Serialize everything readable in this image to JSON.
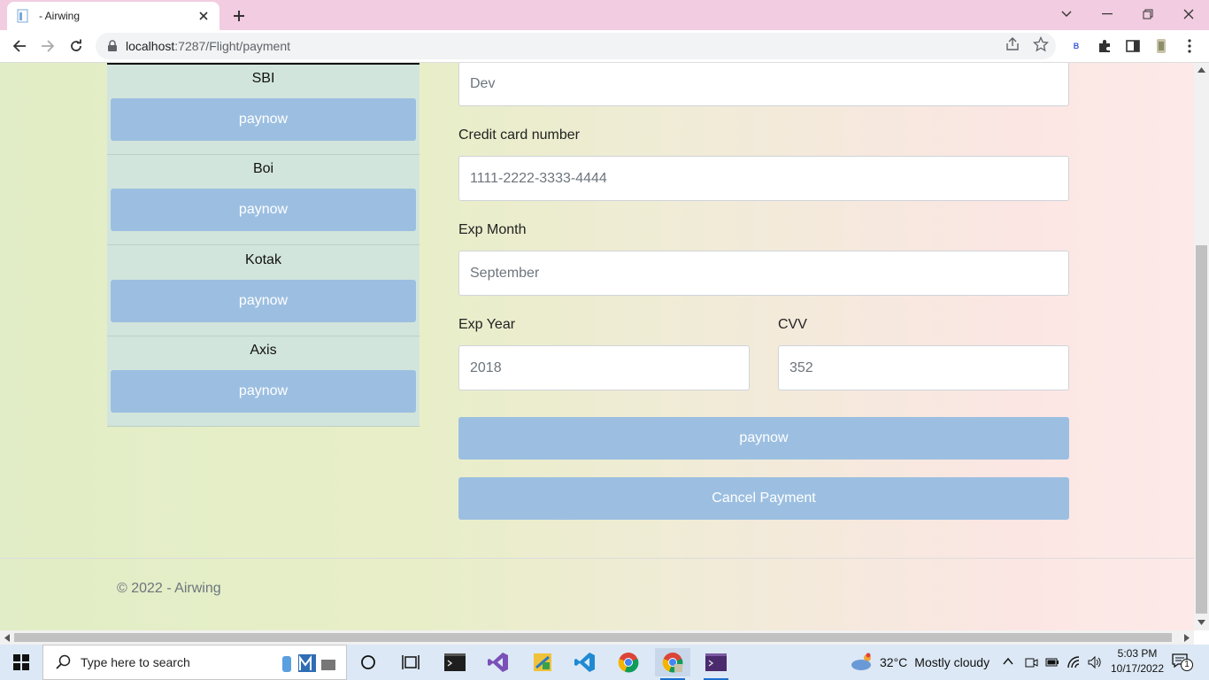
{
  "browser": {
    "tab_title": "- Airwing",
    "url_host": "localhost",
    "url_rest": ":7287/Flight/payment",
    "profile_letter": "B"
  },
  "banks": [
    {
      "name": "SBI",
      "button": "paynow"
    },
    {
      "name": "Boi",
      "button": "paynow"
    },
    {
      "name": "Kotak",
      "button": "paynow"
    },
    {
      "name": "Axis",
      "button": "paynow"
    }
  ],
  "form": {
    "name_value": "Dev",
    "card_label": "Credit card number",
    "card_value": "1111-2222-3333-4444",
    "month_label": "Exp Month",
    "month_value": "September",
    "year_label": "Exp Year",
    "year_value": "2018",
    "cvv_label": "CVV",
    "cvv_value": "352",
    "pay_button": "paynow",
    "cancel_button": "Cancel Payment"
  },
  "footer": {
    "text": "© 2022 - Airwing"
  },
  "taskbar": {
    "search_placeholder": "Type here to search",
    "weather_temp": "32°C",
    "weather_desc": "Mostly cloudy",
    "time": "5:03 PM",
    "date": "10/17/2022",
    "notification_count": "1"
  },
  "colors": {
    "button": "#9cbfe1",
    "tab_strip": "#f2cce0",
    "bank_panel": "#d2e5dc"
  }
}
